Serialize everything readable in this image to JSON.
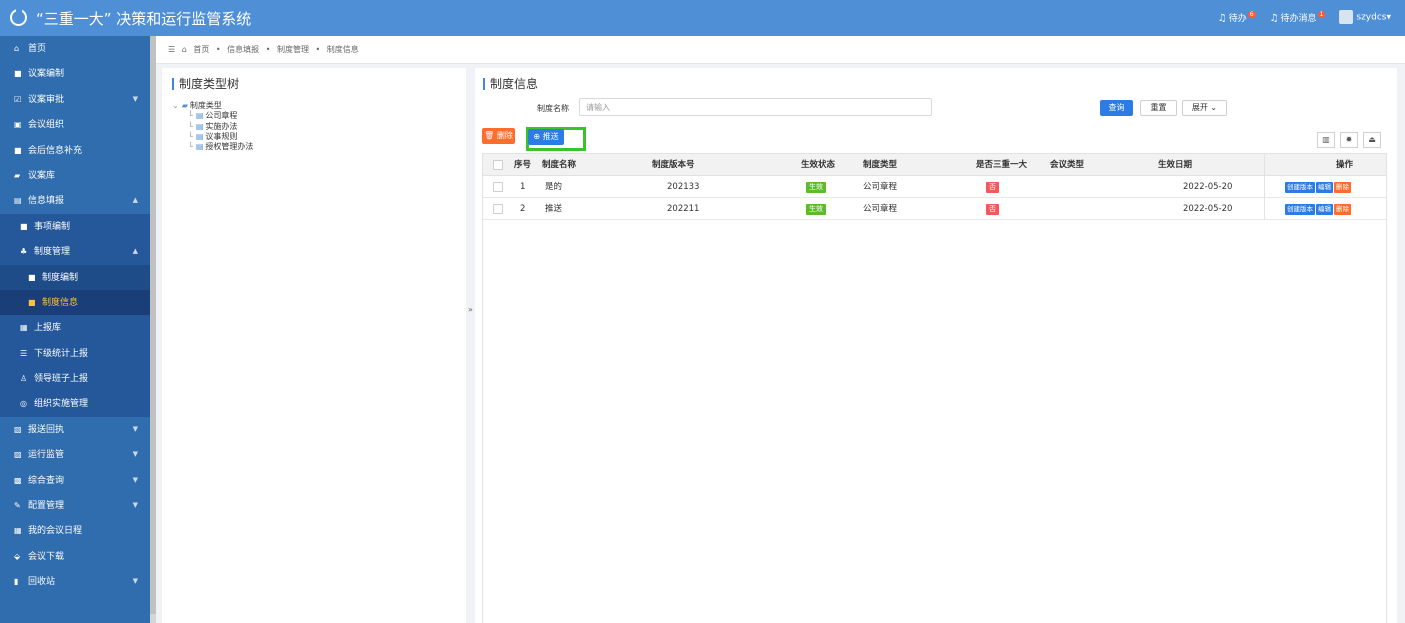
{
  "app": {
    "title": "“三重一大” 决策和运行监管系统"
  },
  "topbar": {
    "todo_label": "待办",
    "todo_badge": "6",
    "msg_label": "待办消息",
    "msg_badge": "1",
    "user": "szydcs▾"
  },
  "sidebar": {
    "items": [
      {
        "label": "首页",
        "icon": "home-icon"
      },
      {
        "label": "议案编制",
        "icon": "doc-icon"
      },
      {
        "label": "议案审批",
        "icon": "check-icon"
      },
      {
        "label": "会议组织",
        "icon": "meeting-icon"
      },
      {
        "label": "会后信息补充",
        "icon": "doc-icon"
      },
      {
        "label": "议案库",
        "icon": "folder-icon"
      },
      {
        "label": "信息填报",
        "icon": "form-icon"
      },
      {
        "label": "事项编制",
        "icon": "doc-icon"
      },
      {
        "label": "制度管理",
        "icon": "users-icon"
      },
      {
        "label": "制度编制",
        "icon": "doc-icon"
      },
      {
        "label": "制度信息",
        "icon": "doc-icon"
      },
      {
        "label": "上报库",
        "icon": "grid-icon"
      },
      {
        "label": "下级统计上报",
        "icon": "list-icon"
      },
      {
        "label": "领导班子上报",
        "icon": "user-icon"
      },
      {
        "label": "组织实施管理",
        "icon": "circle-icon"
      },
      {
        "label": "报送回执",
        "icon": "receipt-icon"
      },
      {
        "label": "运行监管",
        "icon": "monitor-icon"
      },
      {
        "label": "综合查询",
        "icon": "search-icon"
      },
      {
        "label": "配置管理",
        "icon": "gear-icon"
      },
      {
        "label": "我的会议日程",
        "icon": "calendar-icon"
      },
      {
        "label": "会议下载",
        "icon": "download-icon"
      },
      {
        "label": "回收站",
        "icon": "trash-icon"
      }
    ]
  },
  "breadcrumb": {
    "items": [
      "首页",
      "信息填报",
      "制度管理",
      "制度信息"
    ],
    "sep": "•"
  },
  "tree_panel": {
    "title": "制度类型树",
    "root": "制度类型",
    "children": [
      "公司章程",
      "实施办法",
      "议事规则",
      "授权管理办法"
    ]
  },
  "main": {
    "title": "制度信息",
    "filter_label": "制度名称",
    "filter_placeholder": "请输入",
    "query_label": "查询",
    "reset_label": "重置",
    "expand_label": "展开 ⌄",
    "delete_label": "🗑 删除",
    "push_label": "⊕ 推送",
    "columns": [
      "序号",
      "制度名称",
      "制度版本号",
      "生效状态",
      "制度类型",
      "是否三重一大",
      "会议类型",
      "生效日期",
      "操作"
    ],
    "rows": [
      {
        "no": "1",
        "name": "是的",
        "version": "202133",
        "status": "生效",
        "type": "公司章程",
        "is_sanzhong": "否",
        "meeting_type": "",
        "date": "2022-05-20"
      },
      {
        "no": "2",
        "name": "推送",
        "version": "202211",
        "status": "生效",
        "type": "公司章程",
        "is_sanzhong": "否",
        "meeting_type": "",
        "date": "2022-05-20"
      }
    ],
    "actions": {
      "create": "创建版本",
      "edit": "编辑",
      "delete": "删除"
    },
    "colors": {
      "status_green": "#5bbd2b",
      "no_red": "#f05a5a",
      "primary": "#2d7be5",
      "danger": "#ff6d2d"
    }
  }
}
